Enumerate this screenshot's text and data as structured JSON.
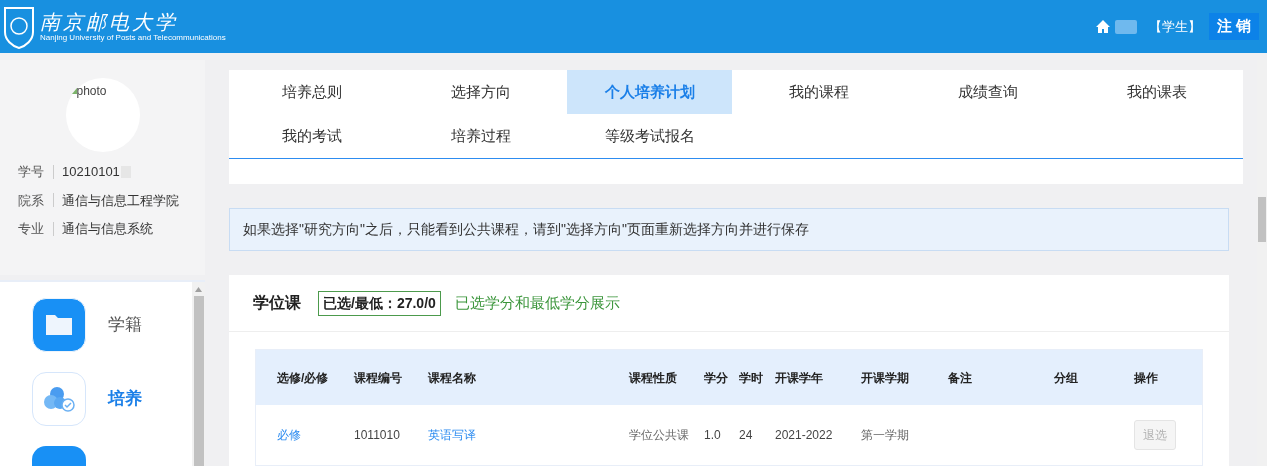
{
  "header": {
    "logo_title": "南京邮电大学",
    "logo_subtitle": "Nanjing University of Posts and Telecommunications",
    "role": "【学生】",
    "logout": "注 销"
  },
  "profile": {
    "photo_alt": "photo",
    "fields": [
      {
        "label": "学号",
        "value": "10210101"
      },
      {
        "label": "院系",
        "value": "通信与信息工程学院"
      },
      {
        "label": "专业",
        "value": "通信与信息系统"
      }
    ]
  },
  "nav_items": [
    {
      "label": "学籍",
      "kind": "folder",
      "selected": false
    },
    {
      "label": "培养",
      "kind": "cloud",
      "selected": true
    }
  ],
  "tabs": [
    {
      "label": "培养总则",
      "selected": false
    },
    {
      "label": "选择方向",
      "selected": false
    },
    {
      "label": "个人培养计划",
      "selected": true
    },
    {
      "label": "我的课程",
      "selected": false
    },
    {
      "label": "成绩查询",
      "selected": false
    },
    {
      "label": "我的课表",
      "selected": false
    },
    {
      "label": "我的考试",
      "selected": false
    },
    {
      "label": "培养过程",
      "selected": false
    },
    {
      "label": "等级考试报名",
      "selected": false
    }
  ],
  "notice": "如果选择\"研究方向\"之后，只能看到公共课程，请到\"选择方向\"页面重新选择方向并进行保存",
  "section": {
    "title": "学位课",
    "credit_badge": "已选/最低：27.0/0",
    "credit_note": "已选学分和最低学分展示"
  },
  "table": {
    "columns": [
      "选修/必修",
      "课程编号",
      "课程名称",
      "课程性质",
      "学分",
      "学时",
      "开课学年",
      "开课学期",
      "备注",
      "分组",
      "操作"
    ],
    "rows": [
      {
        "type": "必修",
        "code": "1011010",
        "name": "英语写译",
        "nature": "学位公共课",
        "credit": "1.0",
        "hours": "24",
        "year": "2021-2022",
        "term": "第一学期",
        "action": "退选",
        "action_disabled": true
      }
    ]
  }
}
